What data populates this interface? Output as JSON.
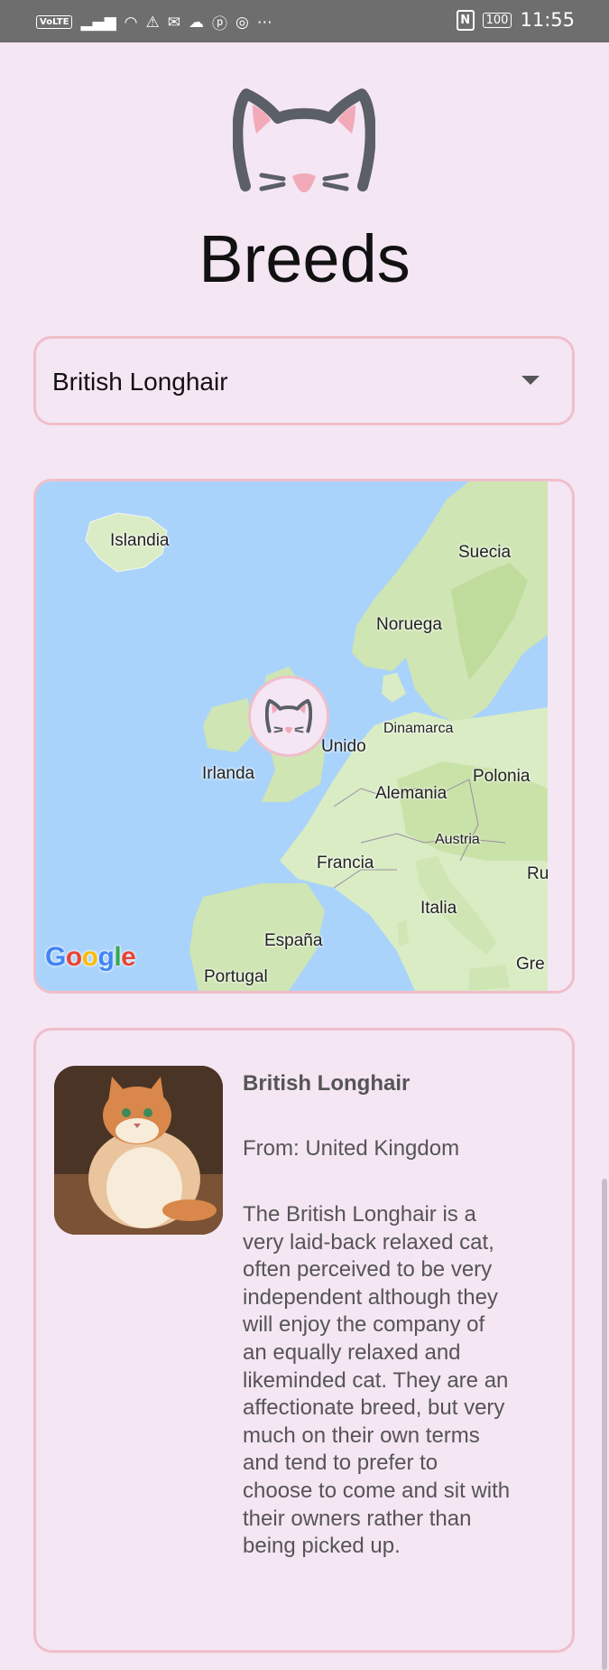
{
  "status_bar": {
    "volte": "VoLTE",
    "battery": "100",
    "time": "11:55"
  },
  "header": {
    "title": "Breeds"
  },
  "breed_select": {
    "selected": "British Longhair"
  },
  "map": {
    "labels": {
      "islandia": "Islandia",
      "suecia": "Suecia",
      "noruega": "Noruega",
      "dinamarca": "Dinamarca",
      "unido": "Unido",
      "irlanda": "Irlanda",
      "polonia": "Polonia",
      "alemania": "Alemania",
      "austria": "Austria",
      "francia": "Francia",
      "ru": "Ru",
      "italia": "Italia",
      "espana": "España",
      "portugal": "Portugal",
      "gre": "Gre"
    },
    "attribution": [
      "G",
      "o",
      "o",
      "g",
      "l",
      "e"
    ]
  },
  "breed_info": {
    "name": "British Longhair",
    "origin": "From: United Kingdom",
    "description": "The British Longhair is a very laid-back relaxed cat, often perceived to be very independent although they will enjoy the company of an equally relaxed and likeminded cat. They are an affectionate breed, but very much on their own terms and tend to prefer to choose to come and sit with their owners rather than being picked up."
  },
  "colors": {
    "background": "#f5e6f4",
    "accent_border": "#efbfcb",
    "water": "#aad3fb"
  }
}
